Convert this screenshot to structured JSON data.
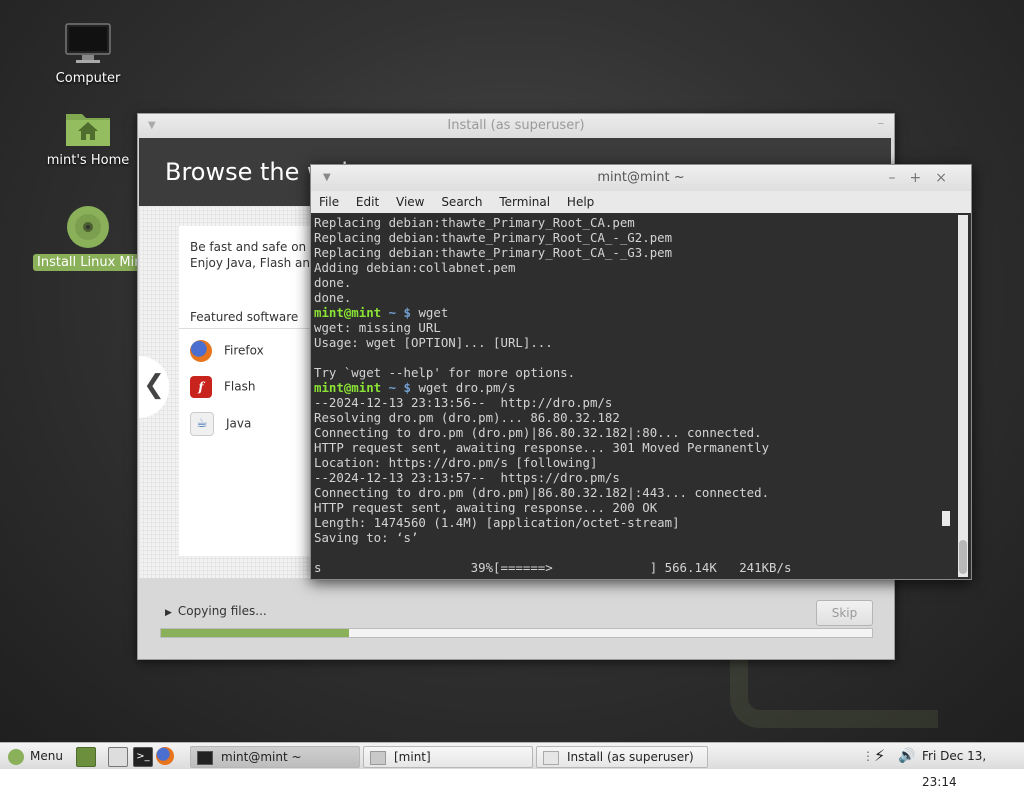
{
  "desktop": {
    "icons": [
      {
        "label": "Computer"
      },
      {
        "label": "mint's Home"
      },
      {
        "label": "Install Linux Mint"
      }
    ]
  },
  "installer": {
    "title": "Install (as superuser)",
    "heading": "Browse the web",
    "description": "Be fast and safe on the web. Firefox. Enjoy Java, Flash and web content.",
    "featured_label": "Featured software",
    "featured": [
      "Firefox",
      "Flash",
      "Java"
    ],
    "status": "Copying files...",
    "skip_label": "Skip",
    "progress": 0.265
  },
  "terminal": {
    "title": "mint@mint ~",
    "menu": [
      "File",
      "Edit",
      "View",
      "Search",
      "Terminal",
      "Help"
    ],
    "prompt_user": "mint@mint",
    "prompt_dir": "~",
    "lines": [
      "Replacing debian:thawte_Primary_Root_CA.pem",
      "Replacing debian:thawte_Primary_Root_CA_-_G2.pem",
      "Replacing debian:thawte_Primary_Root_CA_-_G3.pem",
      "Adding debian:collabnet.pem",
      "done.",
      "done.",
      {
        "prompt": true,
        "cmd": "wget"
      },
      "wget: missing URL",
      "Usage: wget [OPTION]... [URL]...",
      "",
      "Try `wget --help' for more options.",
      {
        "prompt": true,
        "cmd": "wget dro.pm/s"
      },
      "--2024-12-13 23:13:56--  http://dro.pm/s",
      "Resolving dro.pm (dro.pm)... 86.80.32.182",
      "Connecting to dro.pm (dro.pm)|86.80.32.182|:80... connected.",
      "HTTP request sent, awaiting response... 301 Moved Permanently",
      "Location: https://dro.pm/s [following]",
      "--2024-12-13 23:13:57--  https://dro.pm/s",
      "Connecting to dro.pm (dro.pm)|86.80.32.182|:443... connected.",
      "HTTP request sent, awaiting response... 200 OK",
      "Length: 1474560 (1.4M) [application/octet-stream]",
      "Saving to: ‘s’",
      "",
      "s                    39%[======>             ] 566.14K   241KB/s"
    ]
  },
  "taskbar": {
    "menu_label": "Menu",
    "windows": [
      {
        "label": "mint@mint ~",
        "active": true
      },
      {
        "label": "[mint]",
        "active": false
      },
      {
        "label": "Install (as superuser)",
        "active": false
      }
    ],
    "clock": "Fri Dec 13, 23:14"
  },
  "colors": {
    "mint_green": "#8ab05a",
    "prompt_green": "#8ae234",
    "prompt_blue": "#729fcf"
  }
}
